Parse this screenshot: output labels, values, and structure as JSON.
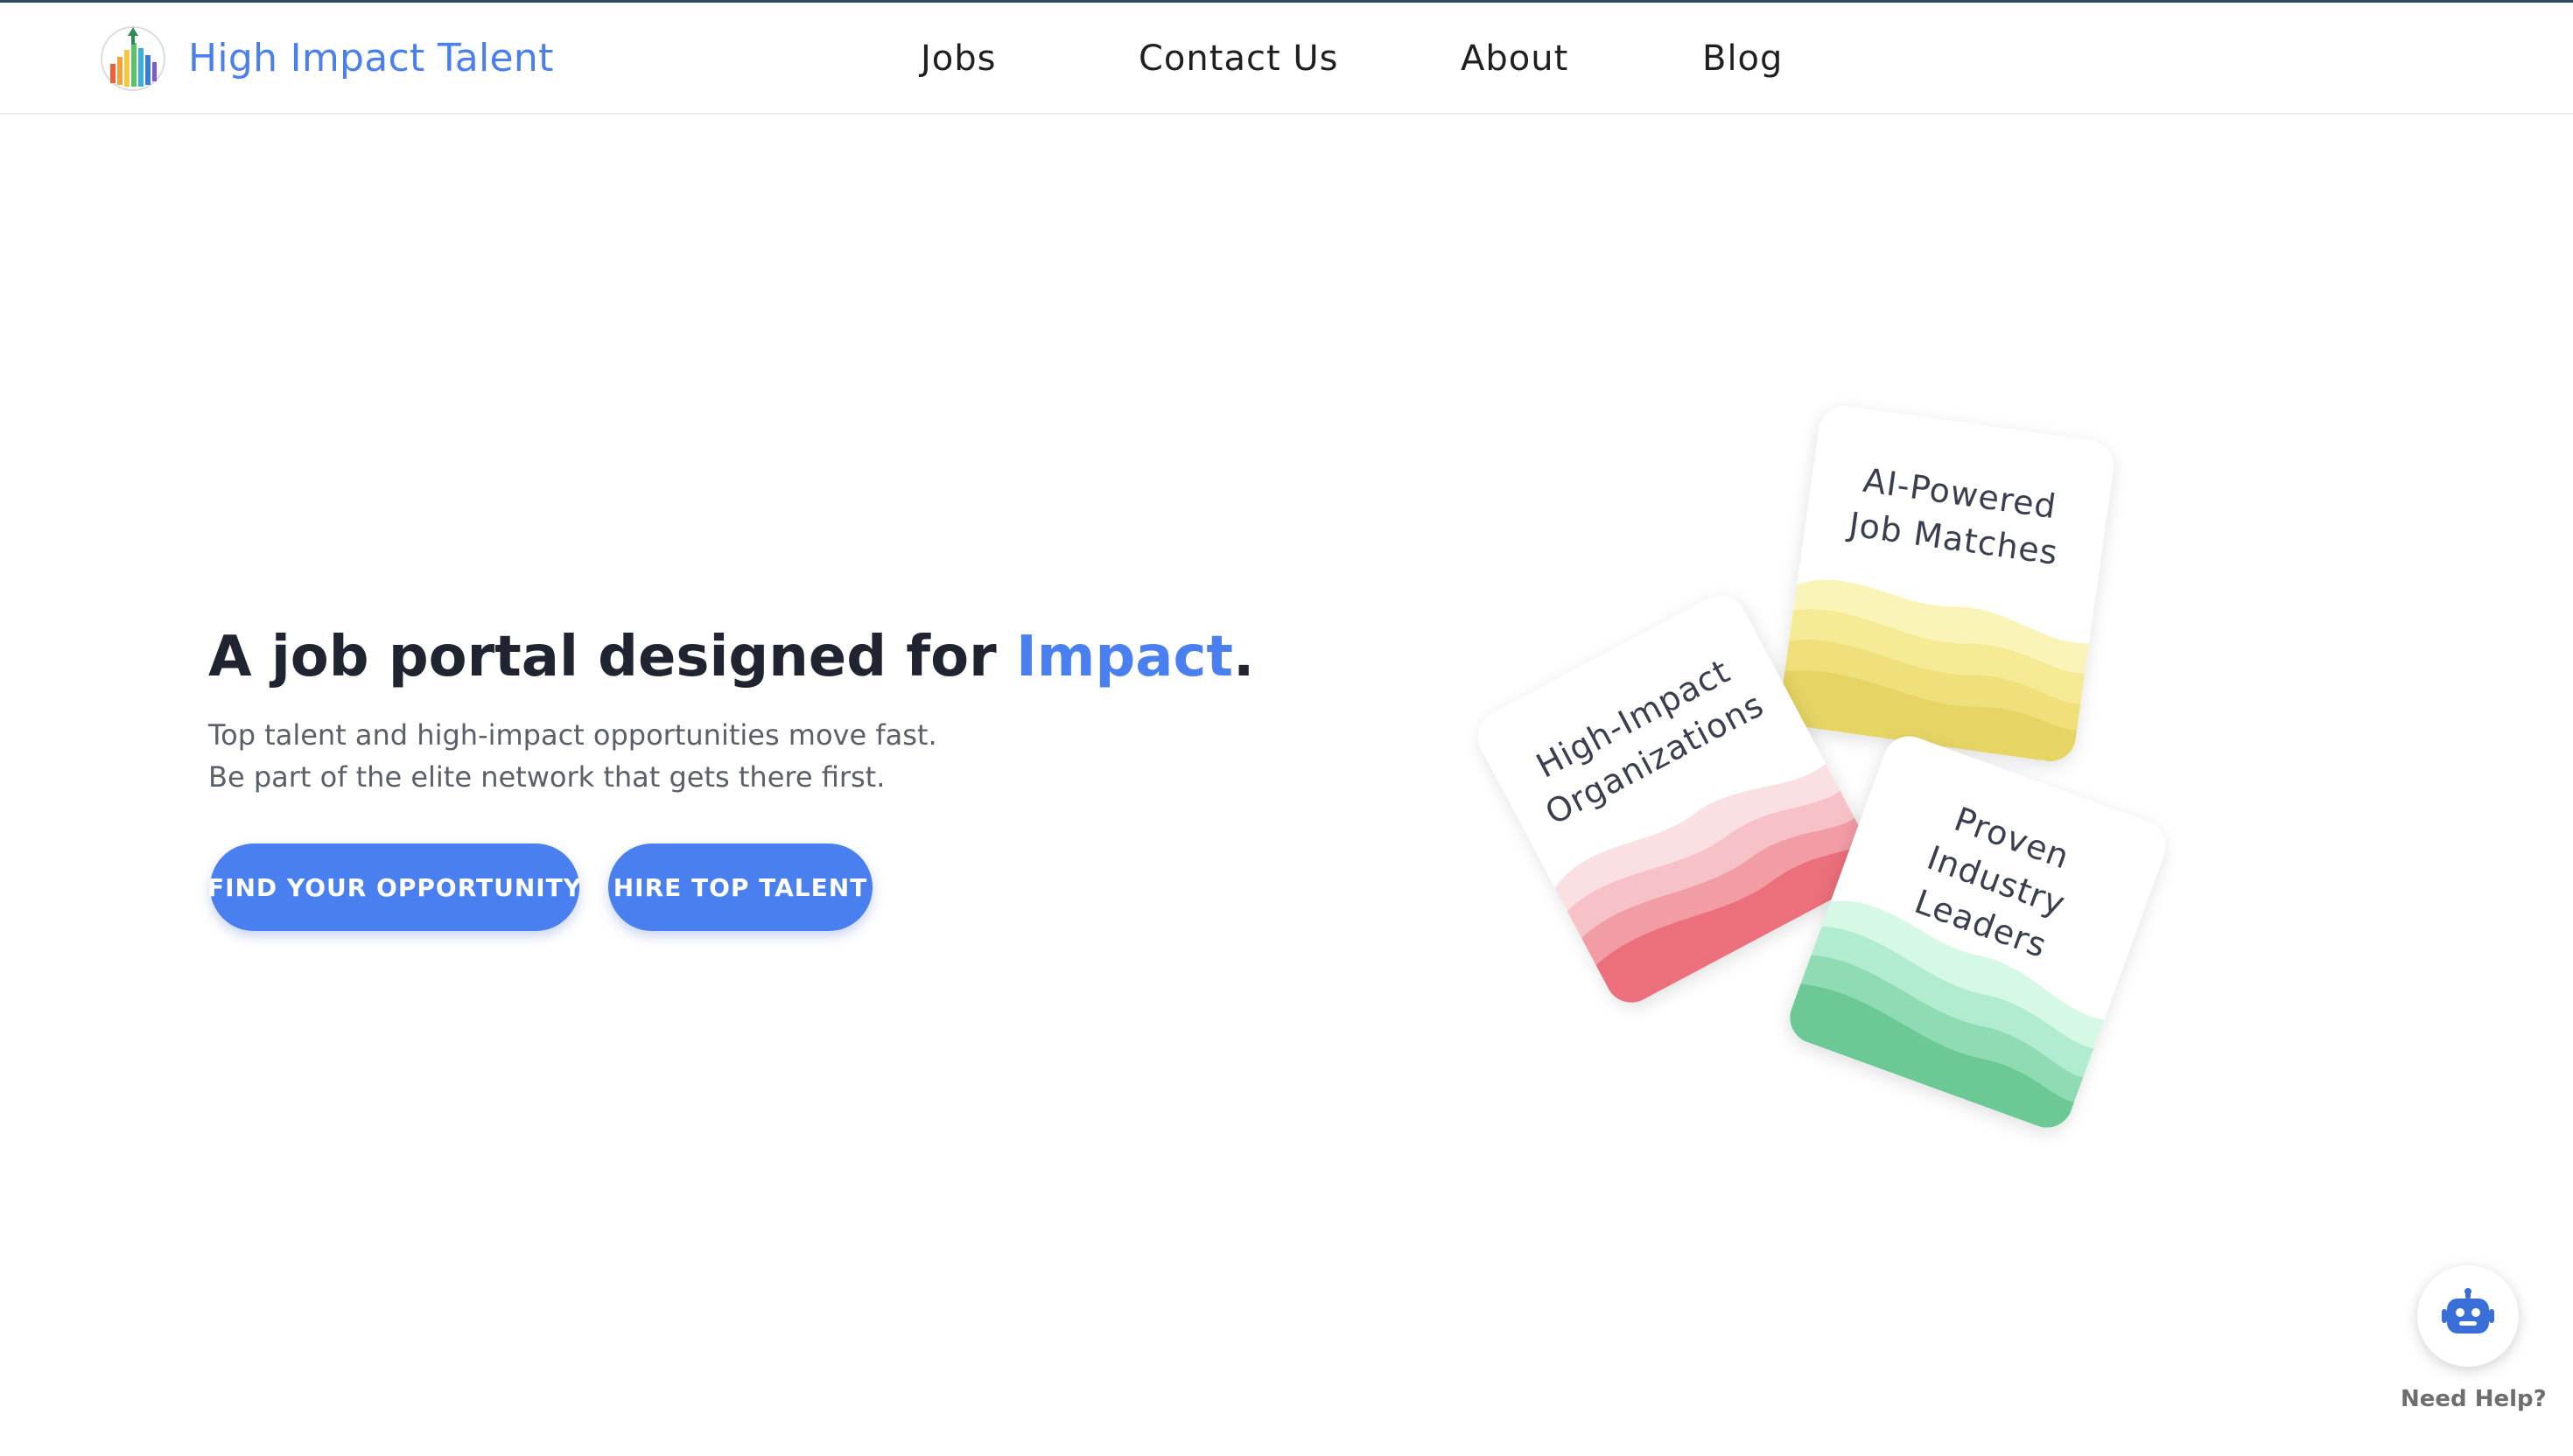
{
  "brand": {
    "name": "High Impact Talent",
    "logo_icon": "bar-chart-arrow-logo-icon"
  },
  "nav": {
    "items": [
      {
        "label": "Jobs"
      },
      {
        "label": "Contact Us"
      },
      {
        "label": "About"
      },
      {
        "label": "Blog"
      }
    ]
  },
  "hero": {
    "title_prefix": "A job portal designed for ",
    "title_accent": "Impact",
    "title_suffix": ".",
    "subtitle_line1": "Top talent and high-impact opportunities move fast.",
    "subtitle_line2": "Be part of the elite network that gets there first.",
    "primary_button": "FIND YOUR OPPORTUNITY",
    "secondary_button": "HIRE TOP TALENT"
  },
  "cards": [
    {
      "line1": "AI-Powered",
      "line2": "Job Matches",
      "line3": "",
      "color": "#e9dc6a"
    },
    {
      "line1": "High-Impact",
      "line2": "Organizations",
      "line3": "",
      "color": "#ec6f7c"
    },
    {
      "line1": "Proven",
      "line2": "Industry",
      "line3": "Leaders",
      "color": "#6cc995"
    }
  ],
  "help": {
    "label": "Need Help?",
    "icon": "robot-icon"
  },
  "colors": {
    "accent": "#4a7ff0",
    "text_dark": "#1f2430",
    "text_muted": "#5a5f69"
  }
}
